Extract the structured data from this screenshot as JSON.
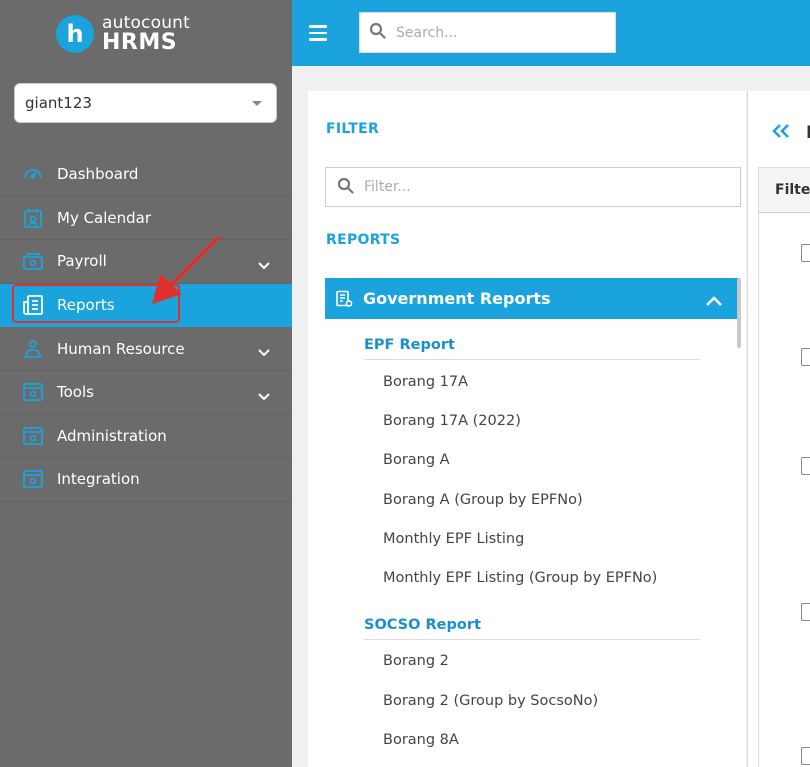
{
  "app": {
    "logo_letter": "h",
    "logo_top": "autocount",
    "logo_bottom": "HRMS"
  },
  "company_select": {
    "value": "giant123"
  },
  "nav": {
    "items": [
      {
        "label": "Dashboard",
        "icon": "gauge-icon",
        "has_chevron": false,
        "active": false
      },
      {
        "label": "My Calendar",
        "icon": "calendar-user-icon",
        "has_chevron": false,
        "active": false
      },
      {
        "label": "Payroll",
        "icon": "payroll-icon",
        "has_chevron": true,
        "active": false
      },
      {
        "label": "Reports",
        "icon": "report-icon",
        "has_chevron": false,
        "active": true
      },
      {
        "label": "Human Resource",
        "icon": "human-resource-icon",
        "has_chevron": true,
        "active": false
      },
      {
        "label": "Tools",
        "icon": "tools-icon",
        "has_chevron": true,
        "active": false
      },
      {
        "label": "Administration",
        "icon": "administration-icon",
        "has_chevron": false,
        "active": false
      },
      {
        "label": "Integration",
        "icon": "integration-icon",
        "has_chevron": false,
        "active": false
      }
    ]
  },
  "topbar": {
    "search_placeholder": "Search..."
  },
  "filter_panel": {
    "filter_title": "FILTER",
    "filter_placeholder": "Filter...",
    "reports_title": "REPORTS",
    "group_label": "Government Reports",
    "epf": {
      "title": "EPF Report",
      "items": [
        "Borang 17A",
        "Borang 17A (2022)",
        "Borang A",
        "Borang A (Group by EPFNo)",
        "Monthly EPF Listing",
        "Monthly EPF Listing (Group by EPFNo)"
      ]
    },
    "socso": {
      "title": "SOCSO Report",
      "items": [
        "Borang 2",
        "Borang 2 (Group by SocsoNo)",
        "Borang 8A"
      ]
    }
  },
  "right_panel": {
    "title": "F",
    "filter_tab": "Filter"
  },
  "colors": {
    "accent": "#1aa3dc",
    "sidebar_bg": "#6b6b6b",
    "highlight_red": "#e0302b",
    "group_title": "#1a8fd0"
  }
}
